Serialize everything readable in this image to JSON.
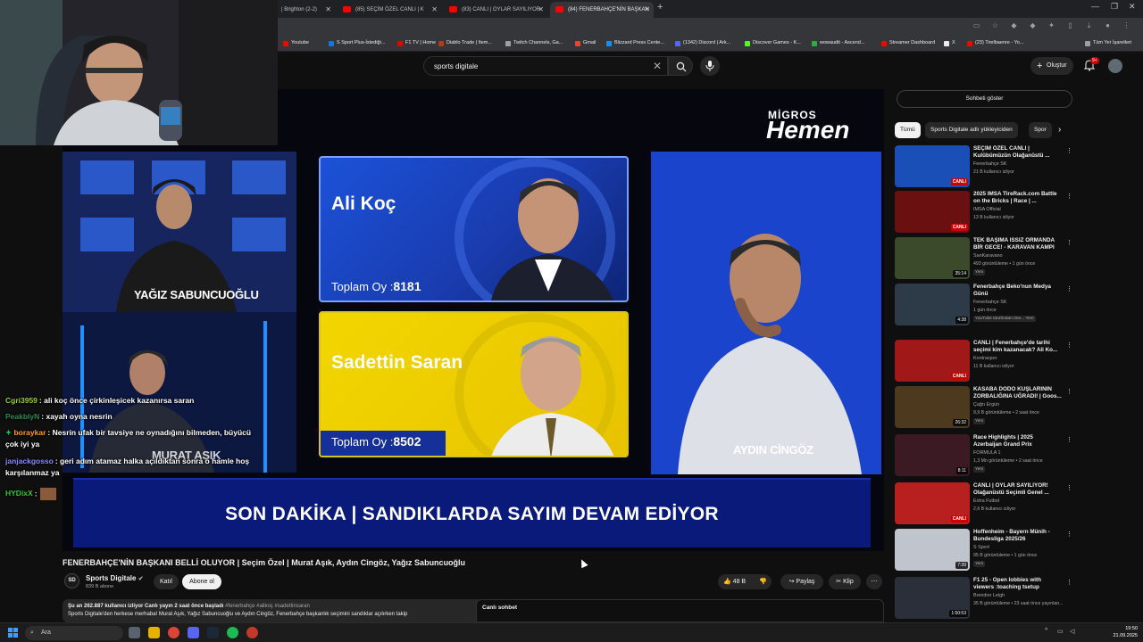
{
  "tabs": [
    {
      "label": "| Brighton (2-2)"
    },
    {
      "label": "(85) SEÇİM ÖZEL CANLI | K"
    },
    {
      "label": "(83) CANLI | OYLAR SAYILIYOR"
    },
    {
      "label": "(84) FENERBAHÇE'NİN BAŞKAN"
    }
  ],
  "bookmarks": [
    "Youtube",
    "S Sport Plus-İstediği...",
    "F1 TV | Home",
    "Diablo Trade | Item...",
    "Twitch Channels, Ga...",
    "Gmail",
    "Blizzard Press Cente...",
    "(1342) Discord | Ark...",
    "Discover Games - K...",
    "wowaudit - Ascend...",
    "Streamer Dashboard",
    "X",
    "(23) Tirelbaenre - Yo...",
    "Tüm Yer İşaretleri"
  ],
  "search": {
    "value": "sports digitale"
  },
  "header": {
    "create_label": "Oluştur",
    "notif_count": "9+"
  },
  "video": {
    "sponsor_top": "MİGROS",
    "sponsor_main": "Hemen",
    "candidate1": {
      "name": "Ali Koç",
      "vote_label": "Toplam Oy :",
      "votes": "8181"
    },
    "candidate2": {
      "name": "Sadettin Saran",
      "vote_label": "Toplam Oy :",
      "votes": "8502"
    },
    "guest_top": "YAĞIZ SABUNCUOĞLU",
    "guest_bottom": "MURAT AŞIK",
    "guest_right": "AYDIN CİNGÖZ",
    "studio_logo": "SD",
    "ticker": "SON DAKİKA | SANDIKLARDA SAYIM DEVAM EDİYOR"
  },
  "chat_overlay": [
    {
      "user": "Cgri3959",
      "text": ": ali koç önce çirkinleşicek kazanırsa saran"
    },
    {
      "user": "PeakblyN",
      "text": ": xayah oyna nesrin"
    },
    {
      "user": "boraykar",
      "text": ": Nesrin ufak bir tavsiye ne oynadığını bilmeden, büyücü"
    },
    {
      "user": "",
      "text": "çok iyi ya"
    },
    {
      "user": "janjackgosso",
      "text": ": geri adım atamaz halka açıldıktan sonra o hamle hoş"
    },
    {
      "user": "",
      "text": "karşılanmaz ya"
    },
    {
      "user": "HYDixX",
      "text": ":"
    }
  ],
  "below": {
    "title": "FENERBAHÇE'NİN BAŞKANI BELLİ OLUYOR | Seçim Özel | Murat Aşık, Aydın Cingöz, Yağız Sabuncuoğlu",
    "channel_logo": "SD",
    "channel": "Sports Digitale",
    "subs": "839 B abone",
    "join": "Katıl",
    "subscribe": "Abone ol",
    "likes": "48 B",
    "share": "Paylaş",
    "clip": "Klip",
    "desc_meta": "Şu an 262.887 kullanıcı izliyor  Canlı yayın 2 saat önce başladı",
    "desc_tags": "#fenerbahçe #alikoç #sadettinsaran",
    "desc_text": "Sports Digitale'den herkese merhaba! Murat Aşık, Yağız Sabuncuoğlu ve Aydın Cingöz, Fenerbahçe başkanlık seçimini sandıklar açılırken takip",
    "live_chat": "Canlı sohbet"
  },
  "sidebar": {
    "show_chat": "Sohbeti göster",
    "chips": [
      "Tümü",
      "Sports Digitale adlı yükleyiciden",
      "Spor"
    ],
    "items": [
      {
        "title": "SEÇİM ÖZEL CANLI | Kulübümüzün Olağanüstü ...",
        "channel": "Fenerbahçe SK",
        "meta": "21 B kullanıcı izliyor",
        "badge": "",
        "overlay": "CANLI",
        "thumb": "#1b4fb8"
      },
      {
        "title": "2025 IMSA TireRack.com Battle on the Bricks | Race | ...",
        "channel": "IMSA Official",
        "meta": "13 B kullanıcı izliyor",
        "badge": "",
        "overlay": "CANLI",
        "thumb": "#6b1010"
      },
      {
        "title": "TEK BAŞIMA ISSIZ ORMANDA BİR GECE! - KARAVAN KAMPI",
        "channel": "SanKaravano",
        "meta": "493 görüntüleme • 1 gün önce",
        "badge": "Yeni",
        "overlay": "35:14",
        "thumb": "#3a4a2a"
      },
      {
        "title": "Fenerbahçe Beko'nun Medya Günü",
        "channel": "Fenerbahçe SK",
        "meta": "1 gün önce",
        "badge": "YouTube tarafından öne...   Yeni",
        "overlay": "4:38",
        "thumb": "#2d3a48"
      },
      {
        "title": "CANLI | Fenerbahçe'de tarihi seçimi kim kazanacak? Ali Ko...",
        "channel": "Kontraspor",
        "meta": "11 B kullanıcı izliyor",
        "badge": "",
        "overlay": "CANLI",
        "thumb": "#a01818"
      },
      {
        "title": "KASABA DODO KUŞLARININ ZORBALIĞINA UĞRADI! | Goos...",
        "channel": "Çağrı Ergün",
        "meta": "9,9 B görüntüleme • 2 saat önce",
        "badge": "Yeni",
        "overlay": "26:32",
        "thumb": "#4d3a1e"
      },
      {
        "title": "Race Highlights | 2025 Azerbaijan Grand Prix",
        "channel": "FORMULA 1",
        "meta": "1,3 Mn görüntüleme • 2 saat önce",
        "badge": "Yeni",
        "overlay": "8:11",
        "thumb": "#3c1a24"
      },
      {
        "title": "CANLI | OYLAR SAYILIYOR! Olağanüstü Seçimli Genel ...",
        "channel": "Extra Futbol",
        "meta": "2,6 B kullanıcı izliyor",
        "badge": "",
        "overlay": "CANLI",
        "thumb": "#b82020"
      },
      {
        "title": "Hoffenheim - Bayern Münih - Bundesliga 2025/26",
        "channel": "S Sport",
        "meta": "95 B görüntüleme • 1 gün önce",
        "badge": "Yeni",
        "overlay": "7:39",
        "thumb": "#c0c4cc"
      },
      {
        "title": "F1 25 - Open lobbies with viewers :toaching tsetup",
        "channel": "Brendon Leigh",
        "meta": "35 B görüntüleme • 23 saat önce yayınlan...",
        "badge": "",
        "overlay": "1:50:53",
        "thumb": "#2a2f3a"
      }
    ]
  },
  "taskbar": {
    "search": "Ara",
    "time": "19:50",
    "date": "21.09.2025"
  },
  "colors": {
    "yt_red": "#ff0000",
    "candidate1_bg": "#1b52d8",
    "candidate2_bg": "#f2d600",
    "ticker_bg": "#0a1a7a"
  }
}
